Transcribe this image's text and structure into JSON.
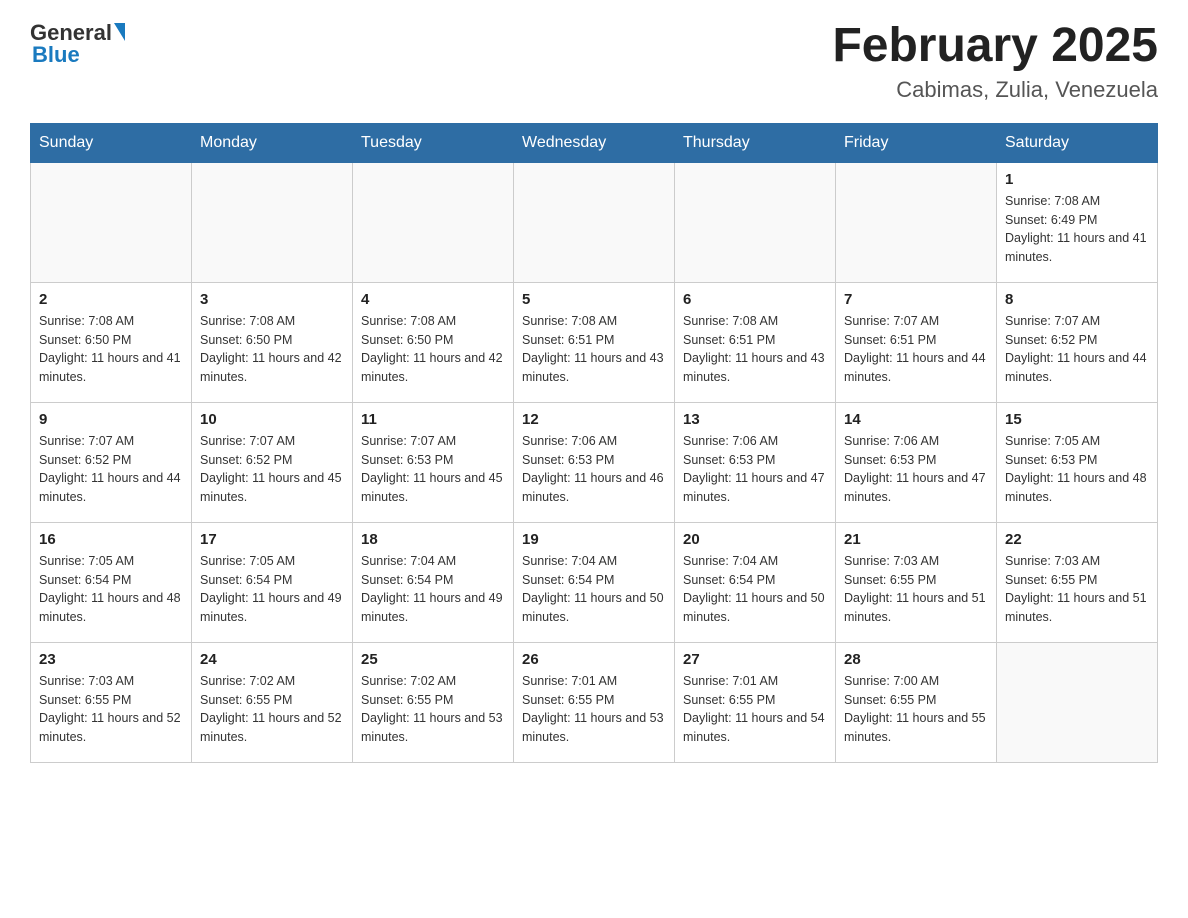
{
  "header": {
    "logo": {
      "general": "General",
      "blue": "Blue"
    },
    "title": "February 2025",
    "subtitle": "Cabimas, Zulia, Venezuela"
  },
  "weekdays": [
    "Sunday",
    "Monday",
    "Tuesday",
    "Wednesday",
    "Thursday",
    "Friday",
    "Saturday"
  ],
  "weeks": [
    [
      {
        "day": "",
        "info": ""
      },
      {
        "day": "",
        "info": ""
      },
      {
        "day": "",
        "info": ""
      },
      {
        "day": "",
        "info": ""
      },
      {
        "day": "",
        "info": ""
      },
      {
        "day": "",
        "info": ""
      },
      {
        "day": "1",
        "info": "Sunrise: 7:08 AM\nSunset: 6:49 PM\nDaylight: 11 hours and 41 minutes."
      }
    ],
    [
      {
        "day": "2",
        "info": "Sunrise: 7:08 AM\nSunset: 6:50 PM\nDaylight: 11 hours and 41 minutes."
      },
      {
        "day": "3",
        "info": "Sunrise: 7:08 AM\nSunset: 6:50 PM\nDaylight: 11 hours and 42 minutes."
      },
      {
        "day": "4",
        "info": "Sunrise: 7:08 AM\nSunset: 6:50 PM\nDaylight: 11 hours and 42 minutes."
      },
      {
        "day": "5",
        "info": "Sunrise: 7:08 AM\nSunset: 6:51 PM\nDaylight: 11 hours and 43 minutes."
      },
      {
        "day": "6",
        "info": "Sunrise: 7:08 AM\nSunset: 6:51 PM\nDaylight: 11 hours and 43 minutes."
      },
      {
        "day": "7",
        "info": "Sunrise: 7:07 AM\nSunset: 6:51 PM\nDaylight: 11 hours and 44 minutes."
      },
      {
        "day": "8",
        "info": "Sunrise: 7:07 AM\nSunset: 6:52 PM\nDaylight: 11 hours and 44 minutes."
      }
    ],
    [
      {
        "day": "9",
        "info": "Sunrise: 7:07 AM\nSunset: 6:52 PM\nDaylight: 11 hours and 44 minutes."
      },
      {
        "day": "10",
        "info": "Sunrise: 7:07 AM\nSunset: 6:52 PM\nDaylight: 11 hours and 45 minutes."
      },
      {
        "day": "11",
        "info": "Sunrise: 7:07 AM\nSunset: 6:53 PM\nDaylight: 11 hours and 45 minutes."
      },
      {
        "day": "12",
        "info": "Sunrise: 7:06 AM\nSunset: 6:53 PM\nDaylight: 11 hours and 46 minutes."
      },
      {
        "day": "13",
        "info": "Sunrise: 7:06 AM\nSunset: 6:53 PM\nDaylight: 11 hours and 47 minutes."
      },
      {
        "day": "14",
        "info": "Sunrise: 7:06 AM\nSunset: 6:53 PM\nDaylight: 11 hours and 47 minutes."
      },
      {
        "day": "15",
        "info": "Sunrise: 7:05 AM\nSunset: 6:53 PM\nDaylight: 11 hours and 48 minutes."
      }
    ],
    [
      {
        "day": "16",
        "info": "Sunrise: 7:05 AM\nSunset: 6:54 PM\nDaylight: 11 hours and 48 minutes."
      },
      {
        "day": "17",
        "info": "Sunrise: 7:05 AM\nSunset: 6:54 PM\nDaylight: 11 hours and 49 minutes."
      },
      {
        "day": "18",
        "info": "Sunrise: 7:04 AM\nSunset: 6:54 PM\nDaylight: 11 hours and 49 minutes."
      },
      {
        "day": "19",
        "info": "Sunrise: 7:04 AM\nSunset: 6:54 PM\nDaylight: 11 hours and 50 minutes."
      },
      {
        "day": "20",
        "info": "Sunrise: 7:04 AM\nSunset: 6:54 PM\nDaylight: 11 hours and 50 minutes."
      },
      {
        "day": "21",
        "info": "Sunrise: 7:03 AM\nSunset: 6:55 PM\nDaylight: 11 hours and 51 minutes."
      },
      {
        "day": "22",
        "info": "Sunrise: 7:03 AM\nSunset: 6:55 PM\nDaylight: 11 hours and 51 minutes."
      }
    ],
    [
      {
        "day": "23",
        "info": "Sunrise: 7:03 AM\nSunset: 6:55 PM\nDaylight: 11 hours and 52 minutes."
      },
      {
        "day": "24",
        "info": "Sunrise: 7:02 AM\nSunset: 6:55 PM\nDaylight: 11 hours and 52 minutes."
      },
      {
        "day": "25",
        "info": "Sunrise: 7:02 AM\nSunset: 6:55 PM\nDaylight: 11 hours and 53 minutes."
      },
      {
        "day": "26",
        "info": "Sunrise: 7:01 AM\nSunset: 6:55 PM\nDaylight: 11 hours and 53 minutes."
      },
      {
        "day": "27",
        "info": "Sunrise: 7:01 AM\nSunset: 6:55 PM\nDaylight: 11 hours and 54 minutes."
      },
      {
        "day": "28",
        "info": "Sunrise: 7:00 AM\nSunset: 6:55 PM\nDaylight: 11 hours and 55 minutes."
      },
      {
        "day": "",
        "info": ""
      }
    ]
  ]
}
